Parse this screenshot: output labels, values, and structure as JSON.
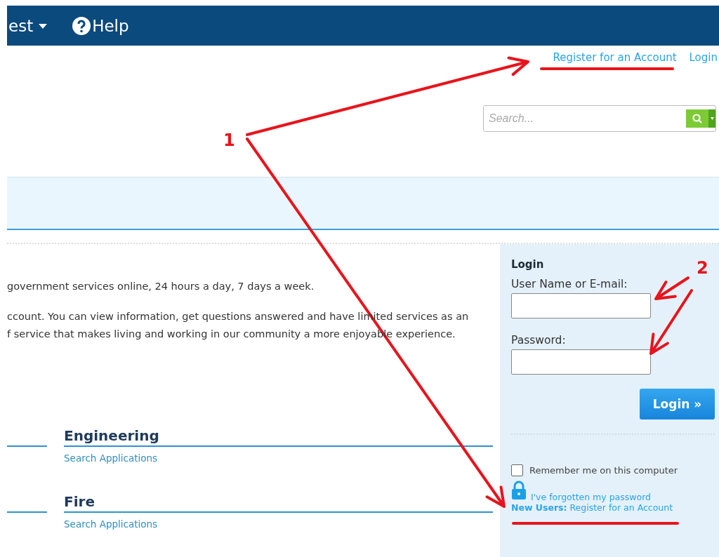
{
  "nav": {
    "items": [
      {
        "kind": "dropdown",
        "label": "est"
      },
      {
        "kind": "help",
        "label": "Help"
      }
    ]
  },
  "top_links": [
    {
      "label": "Register for an Account"
    },
    {
      "label": "Login"
    }
  ],
  "search": {
    "placeholder": "Search..."
  },
  "intro": [
    {
      "lines": [
        "government services online, 24 hours a day, 7 days a week."
      ]
    },
    {
      "lines": [
        "ccount. You can view information, get questions answered and have limited services as an",
        "f service that makes living and working in our community a more enjoyable experience."
      ]
    }
  ],
  "sections": [
    {
      "title": "Engineering",
      "link": "Search Applications"
    },
    {
      "title": "Fire",
      "link": "Search Applications"
    }
  ],
  "login": {
    "title": "Login",
    "fields": [
      {
        "label": "User Name or E-mail:"
      },
      {
        "label": "Password:"
      }
    ],
    "button": "Login »",
    "remember": {
      "label": "Remember me on this computer",
      "checked": false
    },
    "forgot": "I've forgotten my password",
    "new_users": "**New Users:** Register for an Account"
  },
  "annotations": [
    {
      "number": "1"
    },
    {
      "number": "2"
    }
  ]
}
